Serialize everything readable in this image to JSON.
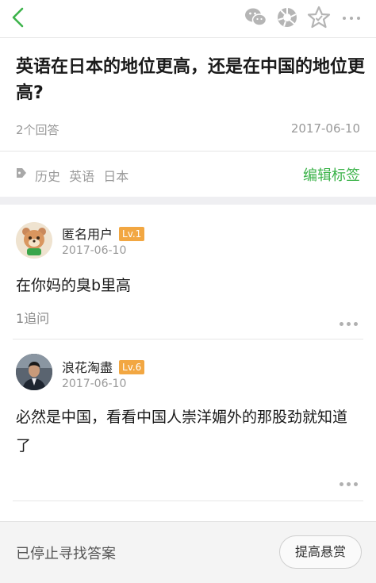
{
  "nav": {
    "icons": [
      "back-arrow-icon",
      "wechat-icon",
      "moments-icon",
      "star-icon",
      "more-icon"
    ],
    "accent": "#3cb34a"
  },
  "question": {
    "title": "英语在日本的地位更高，还是在中国的地位更高?",
    "answer_count": "2个回答",
    "date": "2017-06-10"
  },
  "tags": {
    "items": [
      "历史",
      "英语",
      "日本"
    ],
    "edit_label": "编辑标签"
  },
  "answers": [
    {
      "user": "匿名用户",
      "level": "Lv.1",
      "date": "2017-06-10",
      "text": "在你妈的臭b里高",
      "follow": "1追问"
    },
    {
      "user": "浪花淘盡",
      "level": "Lv.6",
      "date": "2017-06-10",
      "text": "必然是中国，看看中国人崇洋媚外的那股劲就知道了"
    }
  ],
  "footer": {
    "status": "已停止寻找答案",
    "reward_button": "提高悬赏"
  }
}
